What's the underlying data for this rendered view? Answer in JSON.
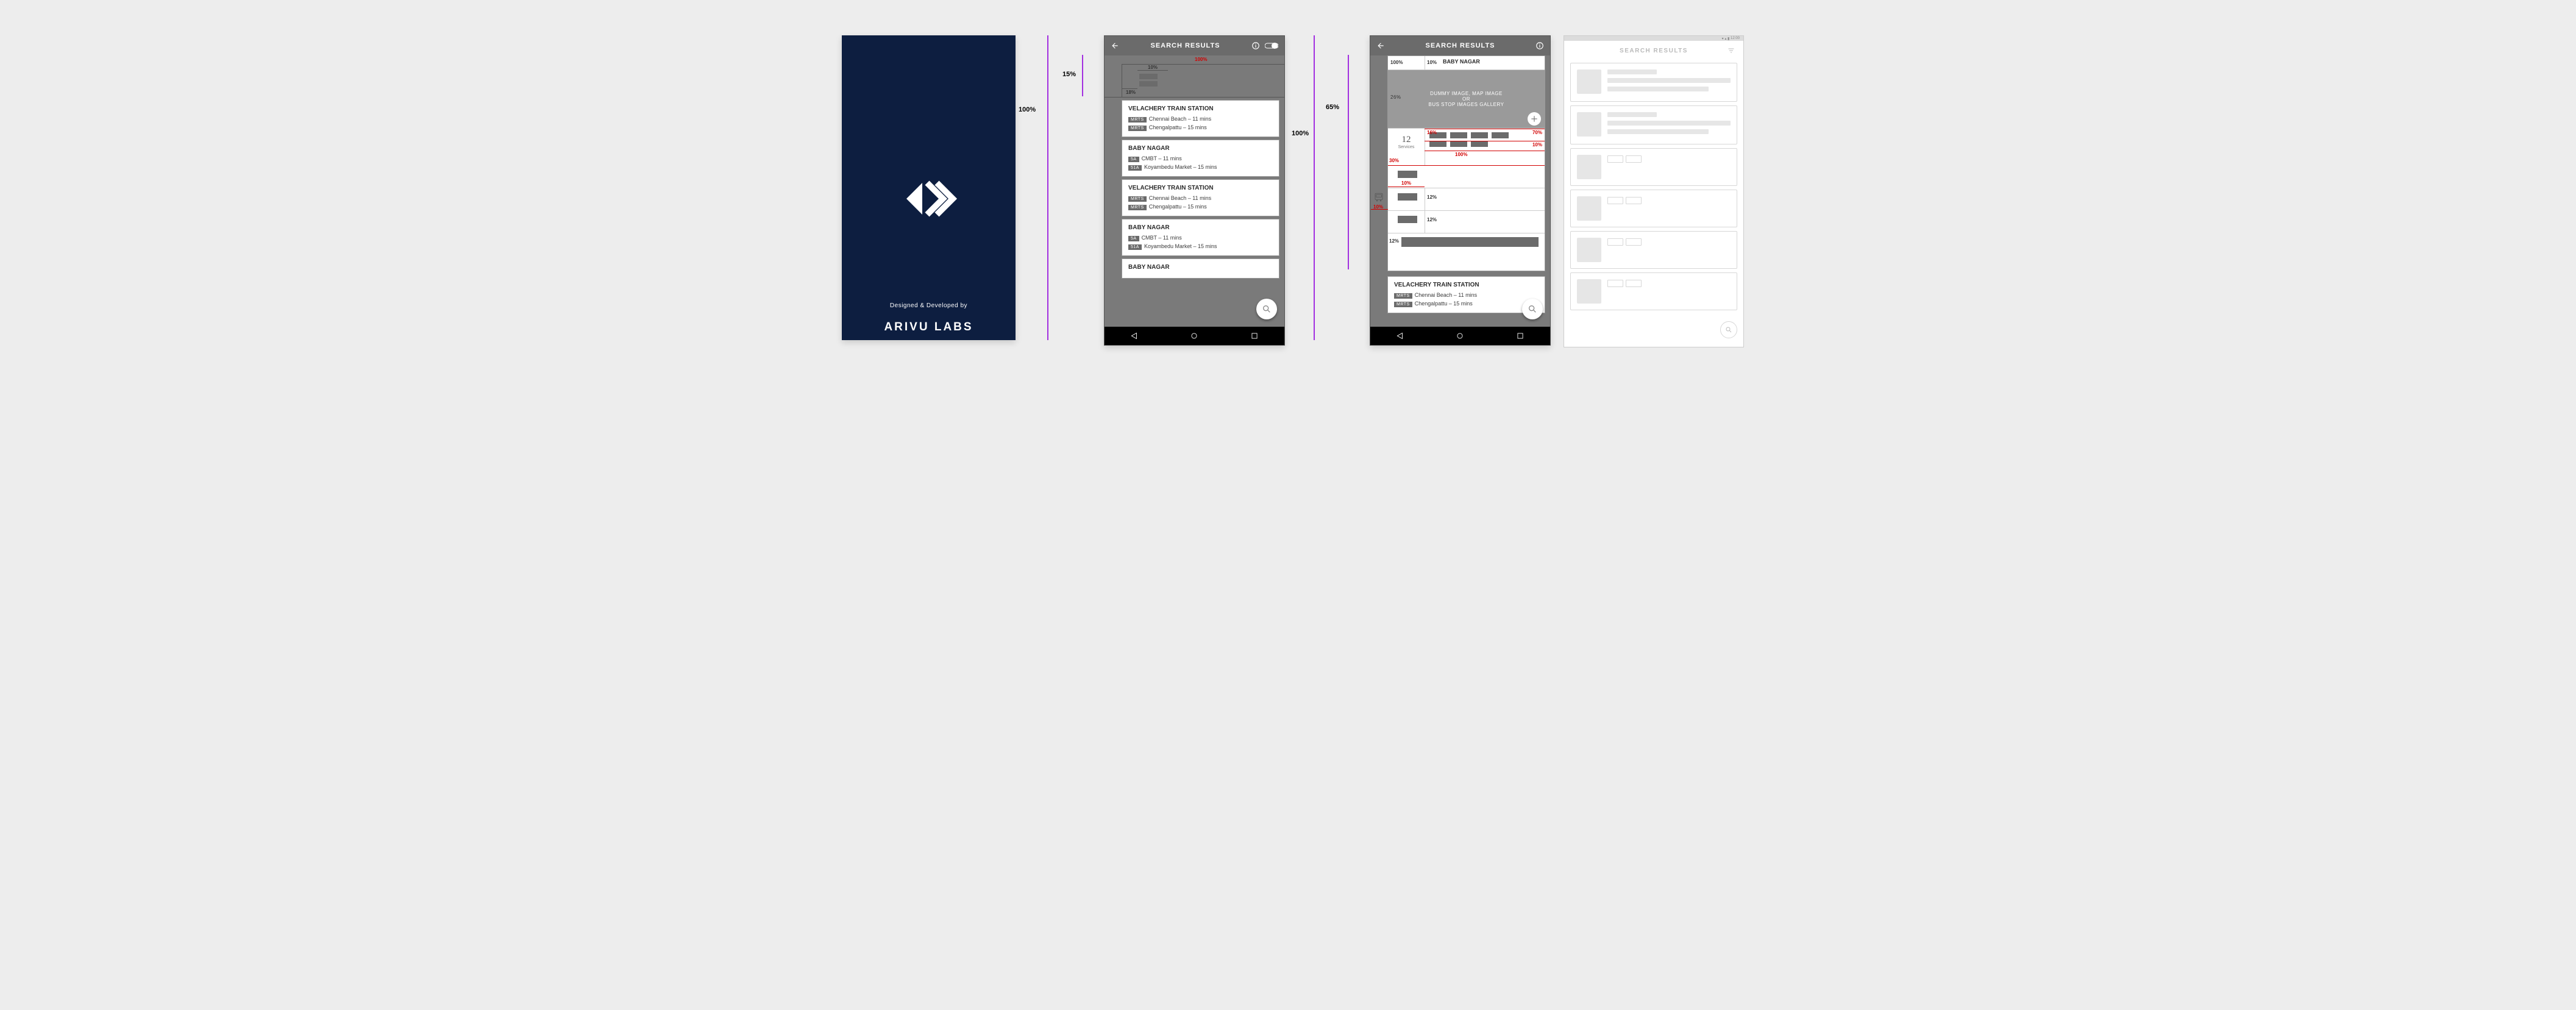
{
  "splash": {
    "subtitle": "Designed & Developed by",
    "title": "ARIVU LABS"
  },
  "labels": {
    "search_results": "SEARCH RESULTS",
    "services": "Services"
  },
  "ann": {
    "h100a": "100%",
    "h100b": "100%",
    "h15": "15%",
    "h65": "65%",
    "p100": "100%",
    "p10": "10%",
    "p18": "18%",
    "r30": "30%",
    "r10": "10%",
    "r12": "12%",
    "r16": "16%",
    "r70": "70%",
    "r26": "26%",
    "r100b": "100%",
    "r10b": "10%",
    "r12b": "12%",
    "r12c": "12%",
    "r10c": "10%",
    "r100c": "100%"
  },
  "screen2": {
    "cards": [
      {
        "title": "VELACHERY TRAIN STATION",
        "rows": [
          {
            "badge": "MRTS",
            "text": "Chennai Beach  – 11 mins"
          },
          {
            "badge": "MRTS",
            "text": "Chengalpattu  – 15 mins"
          }
        ]
      },
      {
        "title": "BABY NAGAR",
        "rows": [
          {
            "badge": "5A",
            "text": "CMBT  – 11 mins"
          },
          {
            "badge": "51A",
            "text": "Koyambedu Market  – 15 mins"
          }
        ]
      },
      {
        "title": "VELACHERY TRAIN STATION",
        "rows": [
          {
            "badge": "MRTS",
            "text": "Chennai Beach  – 11 mins"
          },
          {
            "badge": "MRTS",
            "text": "Chengalpattu  – 15 mins"
          }
        ]
      },
      {
        "title": "BABY NAGAR",
        "rows": [
          {
            "badge": "5A",
            "text": "CMBT  – 11 mins"
          },
          {
            "badge": "51A",
            "text": "Koyambedu Market  – 15 mins"
          }
        ]
      },
      {
        "title": "BABY NAGAR",
        "rows": []
      }
    ]
  },
  "screen3": {
    "expanded_title": "BABY NAGAR",
    "placeholder_line1": "DUMMY IMAGE, MAP IMAGE",
    "placeholder_line2": "OR",
    "placeholder_line3": "BUS STOP IMAGES GALLERY",
    "services_count": "12",
    "next_card": {
      "title": "VELACHERY TRAIN STATION",
      "rows": [
        {
          "badge": "MRTS",
          "text": "Chennai Beach  – 11 mins"
        },
        {
          "badge": "MRTS",
          "text": "Chengalpattu  – 15 mins"
        }
      ]
    }
  },
  "screen4": {
    "status_time": "12:00",
    "header": "SEARCH RESULTS"
  }
}
